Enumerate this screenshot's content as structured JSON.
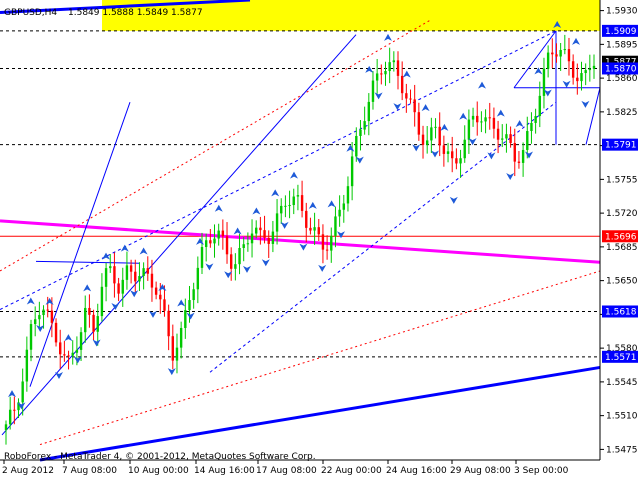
{
  "chart_data": {
    "type": "candlestick",
    "title": "GBPUSD,H4",
    "ohlc_label": "1.5849 1.5888 1.5849 1.5877",
    "footer": "RoboForex - MetaTrader 4, © 2001-2012, MetaQuotes Software Corp.",
    "ylim": [
      1.5464,
      1.5941
    ],
    "y_ticks": [
      "1.5930",
      "1.5895",
      "1.5860",
      "1.5825",
      "1.5790",
      "1.5755",
      "1.5720",
      "1.5685",
      "1.5650",
      "1.5615",
      "1.5580",
      "1.5545",
      "1.5510",
      "1.5475"
    ],
    "x_ticks": [
      "2 Aug 2012",
      "7 Aug 08:00",
      "10 Aug 00:00",
      "14 Aug 16:00",
      "17 Aug 08:00",
      "22 Aug 00:00",
      "24 Aug 16:00",
      "29 Aug 08:00",
      "3 Sep 00:00"
    ],
    "close_path": [
      1.5495,
      1.551,
      1.556,
      1.561,
      1.563,
      1.56,
      1.558,
      1.556,
      1.559,
      1.562,
      1.56,
      1.564,
      1.566,
      1.564,
      1.567,
      1.566,
      1.565,
      1.564,
      1.561,
      1.558,
      1.56,
      1.564,
      1.566,
      1.569,
      1.57,
      1.569,
      1.567,
      1.568,
      1.57,
      1.569,
      1.57,
      1.572,
      1.574,
      1.573,
      1.571,
      1.57,
      1.569,
      1.57,
      1.572,
      1.575,
      1.579,
      1.583,
      1.586,
      1.588,
      1.587,
      1.585,
      1.583,
      1.581,
      1.58,
      1.581,
      1.578,
      1.576,
      1.579,
      1.582,
      1.583,
      1.581,
      1.58,
      1.579,
      1.578,
      1.579,
      1.582,
      1.585,
      1.588,
      1.589,
      1.588,
      1.587,
      1.586,
      1.5877
    ],
    "price_labels": [
      {
        "text": "1.5909",
        "value": 1.5909,
        "color": "#0000ff"
      },
      {
        "text": "1.5877",
        "value": 1.5877,
        "color": "#000000"
      },
      {
        "text": "1.5870",
        "value": 1.587,
        "color": "#0000ff"
      },
      {
        "text": "1.5791",
        "value": 1.5791,
        "color": "#0000ff"
      },
      {
        "text": "1.5696",
        "value": 1.5696,
        "color": "#ff0000"
      },
      {
        "text": "1.5618",
        "value": 1.5618,
        "color": "#0000ff"
      },
      {
        "text": "1.5571",
        "value": 1.5571,
        "color": "#0000ff"
      }
    ],
    "horizontal_levels": [
      1.5909,
      1.587,
      1.5791,
      1.5618,
      1.5571
    ],
    "resistance_level": 1.5696,
    "zone": [
      1.5909,
      1.5941
    ],
    "colors": {
      "bull": "#00c800",
      "bear": "#ff0000",
      "zone": "#ffff00",
      "trend": "#0000ff",
      "magenta": "#ff00ff",
      "support_line": "#ff0000"
    }
  }
}
